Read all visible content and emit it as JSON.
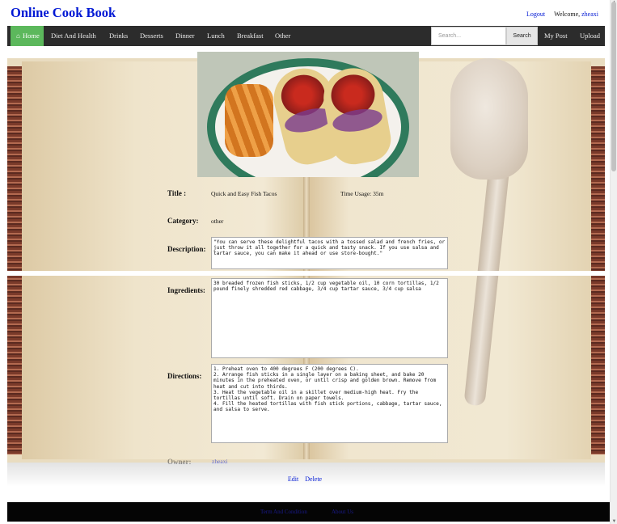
{
  "header": {
    "brand": "Online Cook Book",
    "logout": "Logout",
    "welcome": "Welcome,",
    "username": "zheaxi"
  },
  "nav": {
    "home": "Home",
    "items": [
      "Diet And Health",
      "Drinks",
      "Desserts",
      "Dinner",
      "Lunch",
      "Breakfast",
      "Other"
    ],
    "search_placeholder": "Search...",
    "search_button": "Search",
    "my_post": "My Post",
    "upload": "Upload"
  },
  "recipe": {
    "title_label": "Title :",
    "title": "Quick and Easy Fish Tacos",
    "time_usage": "Time Usage: 35m",
    "category_label": "Category:",
    "category": "other",
    "description_label": "Description:",
    "description": "\"You can serve these delightful tacos with a tossed salad and french fries, or just throw it all together for a quick and tasty snack. If you use salsa and tartar sauce, you can make it ahead or use store-bought.\"",
    "ingredients_label": "Ingredients:",
    "ingredients": "30 breaded frozen fish sticks, 1/2 cup vegetable oil, 10 corn tortillas, 1/2 pound finely shredded red cabbage, 3/4 cup tartar sauce, 3/4 cup salsa",
    "directions_label": "Directions:",
    "directions": "1. Preheat oven to 400 degrees F (200 degrees C).\n2. Arrange fish sticks in a single layer on a baking sheet, and bake 20 minutes in the preheated oven, or until crisp and golden brown. Remove from heat and cut into thirds.\n3. Heat the vegetable oil in a skillet over medium-high heat. Fry the tortillas until soft. Drain on paper towels.\n4. Fill the heated tortillas with fish stick portions, cabbage, tartar sauce, and salsa to serve.",
    "owner_label": "Owner:",
    "owner": "zheaxi"
  },
  "actions": {
    "edit": "Edit",
    "delete": "Delete"
  },
  "footer": {
    "terms": "Term And Condition",
    "about": "About Us"
  },
  "colors": {
    "brand": "#0018d4",
    "home_active": "#5cb85c",
    "navbar": "#2c2c2c"
  }
}
